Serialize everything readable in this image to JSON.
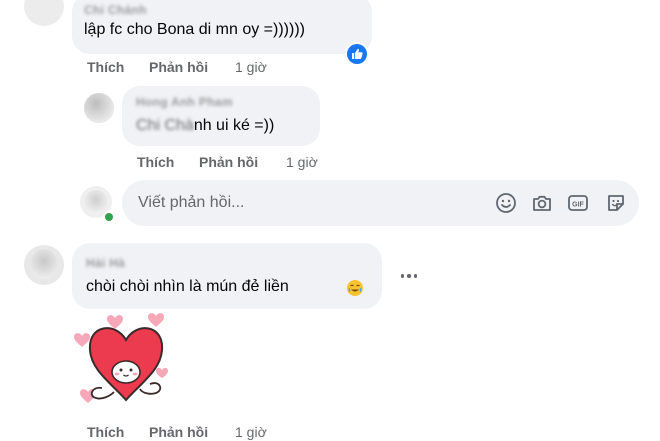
{
  "comments": [
    {
      "author": "Chi Chánh",
      "text": "lập fc cho Bona di mn oy =))))))",
      "actions": {
        "like": "Thích",
        "reply": "Phản hồi",
        "time": "1 giờ"
      }
    },
    {
      "author": "Hong Anh Pham",
      "text_blurred": "Chi Chà",
      "text": "nh ui ké =))",
      "actions": {
        "like": "Thích",
        "reply": "Phản hồi",
        "time": "1 giờ"
      }
    },
    {
      "author": "Hải Hà",
      "text": "chòi chòi nhìn là mún đẻ liền",
      "actions": {
        "like": "Thích",
        "reply": "Phản hồi",
        "time": "1 giờ"
      }
    }
  ],
  "reply_box": {
    "placeholder": "Viết phản hồi..."
  },
  "icons": [
    "like-reaction-icon",
    "emoji-icon",
    "camera-icon",
    "gif-icon",
    "sticker-icon",
    "more-options-icon",
    "crying-laugh-emoji-icon",
    "heart-sticker"
  ],
  "colors": {
    "accent": "#1877f2",
    "bubble": "#f0f2f5",
    "secondary_text": "#65676b",
    "heart": "#ec3b4e"
  }
}
